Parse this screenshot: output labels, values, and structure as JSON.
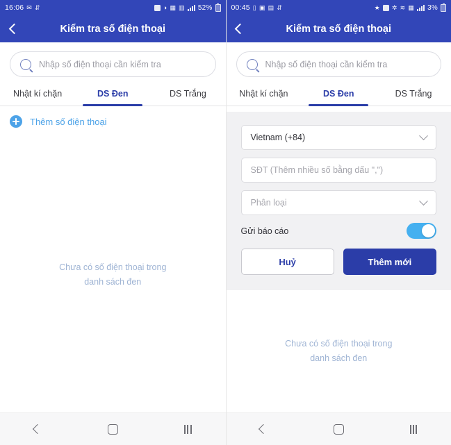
{
  "left": {
    "status": {
      "time": "16:06",
      "battery_pct": "52%",
      "left_icons": [
        "message-icon",
        "data-usage-icon"
      ],
      "right_icons": [
        "screenshot-icon",
        "dnd-icon",
        "dual-sim-icon",
        "nfc-icon",
        "signal-bars-icon",
        "battery-icon"
      ]
    },
    "header": {
      "back_icon": "chevron-left-icon",
      "title": "Kiểm tra số điện thoại"
    },
    "search": {
      "icon": "search-icon",
      "placeholder": "Nhập số điện thoại cần kiểm tra"
    },
    "tabs": [
      {
        "label": "Nhật kí chặn",
        "active": false
      },
      {
        "label": "DS Đen",
        "active": true
      },
      {
        "label": "DS Trắng",
        "active": false
      }
    ],
    "add_row": {
      "icon": "plus-circle-icon",
      "label": "Thêm số điện thoại"
    },
    "empty_state": {
      "line1": "Chưa có số điện thoại trong",
      "line2": "danh sách đen"
    },
    "nav": {
      "back": "nav-back-icon",
      "home": "nav-home-icon",
      "recents": "nav-recents-icon"
    }
  },
  "right": {
    "status": {
      "time": "00:45",
      "battery_pct": "3%",
      "left_icons": [
        "battery-saver-icon",
        "lock-icon",
        "gallery-icon",
        "data-usage-icon"
      ],
      "right_icons": [
        "star-icon",
        "alarm-icon",
        "bluetooth-icon",
        "wifi-icon",
        "dual-sim-icon",
        "signal-bars-icon",
        "battery-icon"
      ]
    },
    "header": {
      "back_icon": "chevron-left-icon",
      "title": "Kiểm tra số điện thoại"
    },
    "search": {
      "icon": "search-icon",
      "placeholder": "Nhập số điện thoại cần kiểm tra"
    },
    "tabs": [
      {
        "label": "Nhật kí chặn",
        "active": false
      },
      {
        "label": "DS Đen",
        "active": true
      },
      {
        "label": "DS Trắng",
        "active": false
      }
    ],
    "form": {
      "country": {
        "value": "Vietnam (+84)",
        "chevron": "chevron-down-icon"
      },
      "phone": {
        "placeholder": "SĐT (Thêm nhiều số bằng dấu \",\")"
      },
      "category": {
        "placeholder": "Phân loại",
        "chevron": "chevron-down-icon"
      },
      "report_toggle": {
        "label": "Gửi báo cáo",
        "on": true
      },
      "cancel_button": "Huỷ",
      "submit_button": "Thêm mới"
    },
    "empty_state": {
      "line1": "Chưa có số điện thoại trong",
      "line2": "danh sách đen"
    },
    "nav": {
      "back": "nav-back-icon",
      "home": "nav-home-icon",
      "recents": "nav-recents-icon"
    }
  },
  "colors": {
    "header_blue": "#3246b8",
    "accent_blue": "#2b3da8",
    "link_blue": "#4da3e8",
    "toggle_on": "#45b0f0",
    "empty_text": "#9fb4d4",
    "panel_gray": "#f1f1f3"
  }
}
